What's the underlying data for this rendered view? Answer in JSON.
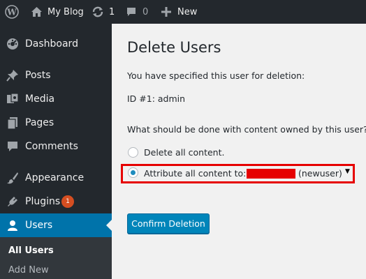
{
  "adminbar": {
    "site_name": "My Blog",
    "updates_count": "1",
    "comments_count": "0",
    "new_label": "New"
  },
  "sidebar": {
    "items": [
      {
        "label": "Dashboard",
        "icon": "dashboard-icon"
      },
      {
        "label": "Posts",
        "icon": "pushpin-icon"
      },
      {
        "label": "Media",
        "icon": "media-icon"
      },
      {
        "label": "Pages",
        "icon": "pages-icon"
      },
      {
        "label": "Comments",
        "icon": "comment-icon"
      },
      {
        "label": "Appearance",
        "icon": "paintbrush-icon"
      },
      {
        "label": "Plugins",
        "icon": "plugin-icon",
        "badge": "1"
      },
      {
        "label": "Users",
        "icon": "user-icon",
        "current": true
      }
    ],
    "submenu": [
      {
        "label": "All Users",
        "active": true
      },
      {
        "label": "Add New"
      }
    ]
  },
  "main": {
    "title": "Delete Users",
    "intro": "You have specified this user for deletion:",
    "user_line": "ID #1: admin",
    "question": "What should be done with content owned by this user?",
    "option_delete": "Delete all content.",
    "option_attribute": "Attribute all content to:",
    "attribute_user": "(newuser)",
    "confirm_button": "Confirm Deletion"
  },
  "colors": {
    "adminbar_bg": "#23282d",
    "sidebar_bg": "#23282d",
    "current_menu_bg": "#0073aa",
    "primary_button": "#0085ba",
    "highlight_border": "#e60000",
    "badge": "#d54e21"
  }
}
